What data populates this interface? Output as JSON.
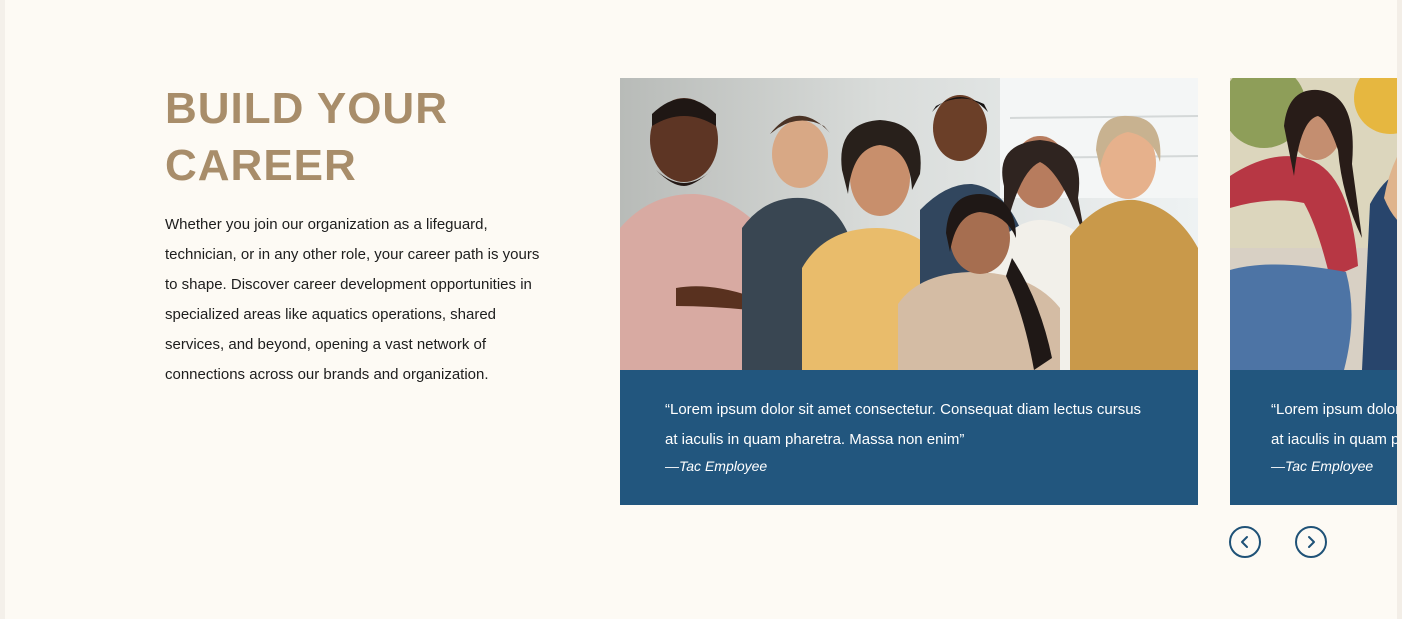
{
  "section": {
    "heading": "BUILD YOUR CAREER",
    "description": "Whether you join our organization as a lifeguard, technician, or in any other role, your career path is yours to shape. Discover career development opportunities in specialized areas like aquatics operations, shared services, and beyond, opening a vast network of connections across our brands and organization."
  },
  "carousel": {
    "cards": [
      {
        "image": "group-of-smiling-employees-photo",
        "quote": "“Lorem ipsum dolor sit amet consectetur. Consequat diam lectus cursus at iaculis in quam pharetra. Massa non enim”",
        "attribution": "—Tac Employee"
      },
      {
        "image": "smiling-woman-sitting-outdoors-photo",
        "quote": "“Lorem ipsum dolor sit amet consectetur. Consequat diam lectus cursus at iaculis in quam pharetra. Massa non enim”",
        "attribution": "—Tac Employee"
      }
    ],
    "controls": {
      "prev_icon": "chevron-left-icon",
      "next_icon": "chevron-right-icon"
    }
  },
  "colors": {
    "page_background": "#fdfaf4",
    "heading": "#a88d6a",
    "body_text": "#1d1d1d",
    "card_blue": "#22567e",
    "control_outline": "#1f5277"
  }
}
